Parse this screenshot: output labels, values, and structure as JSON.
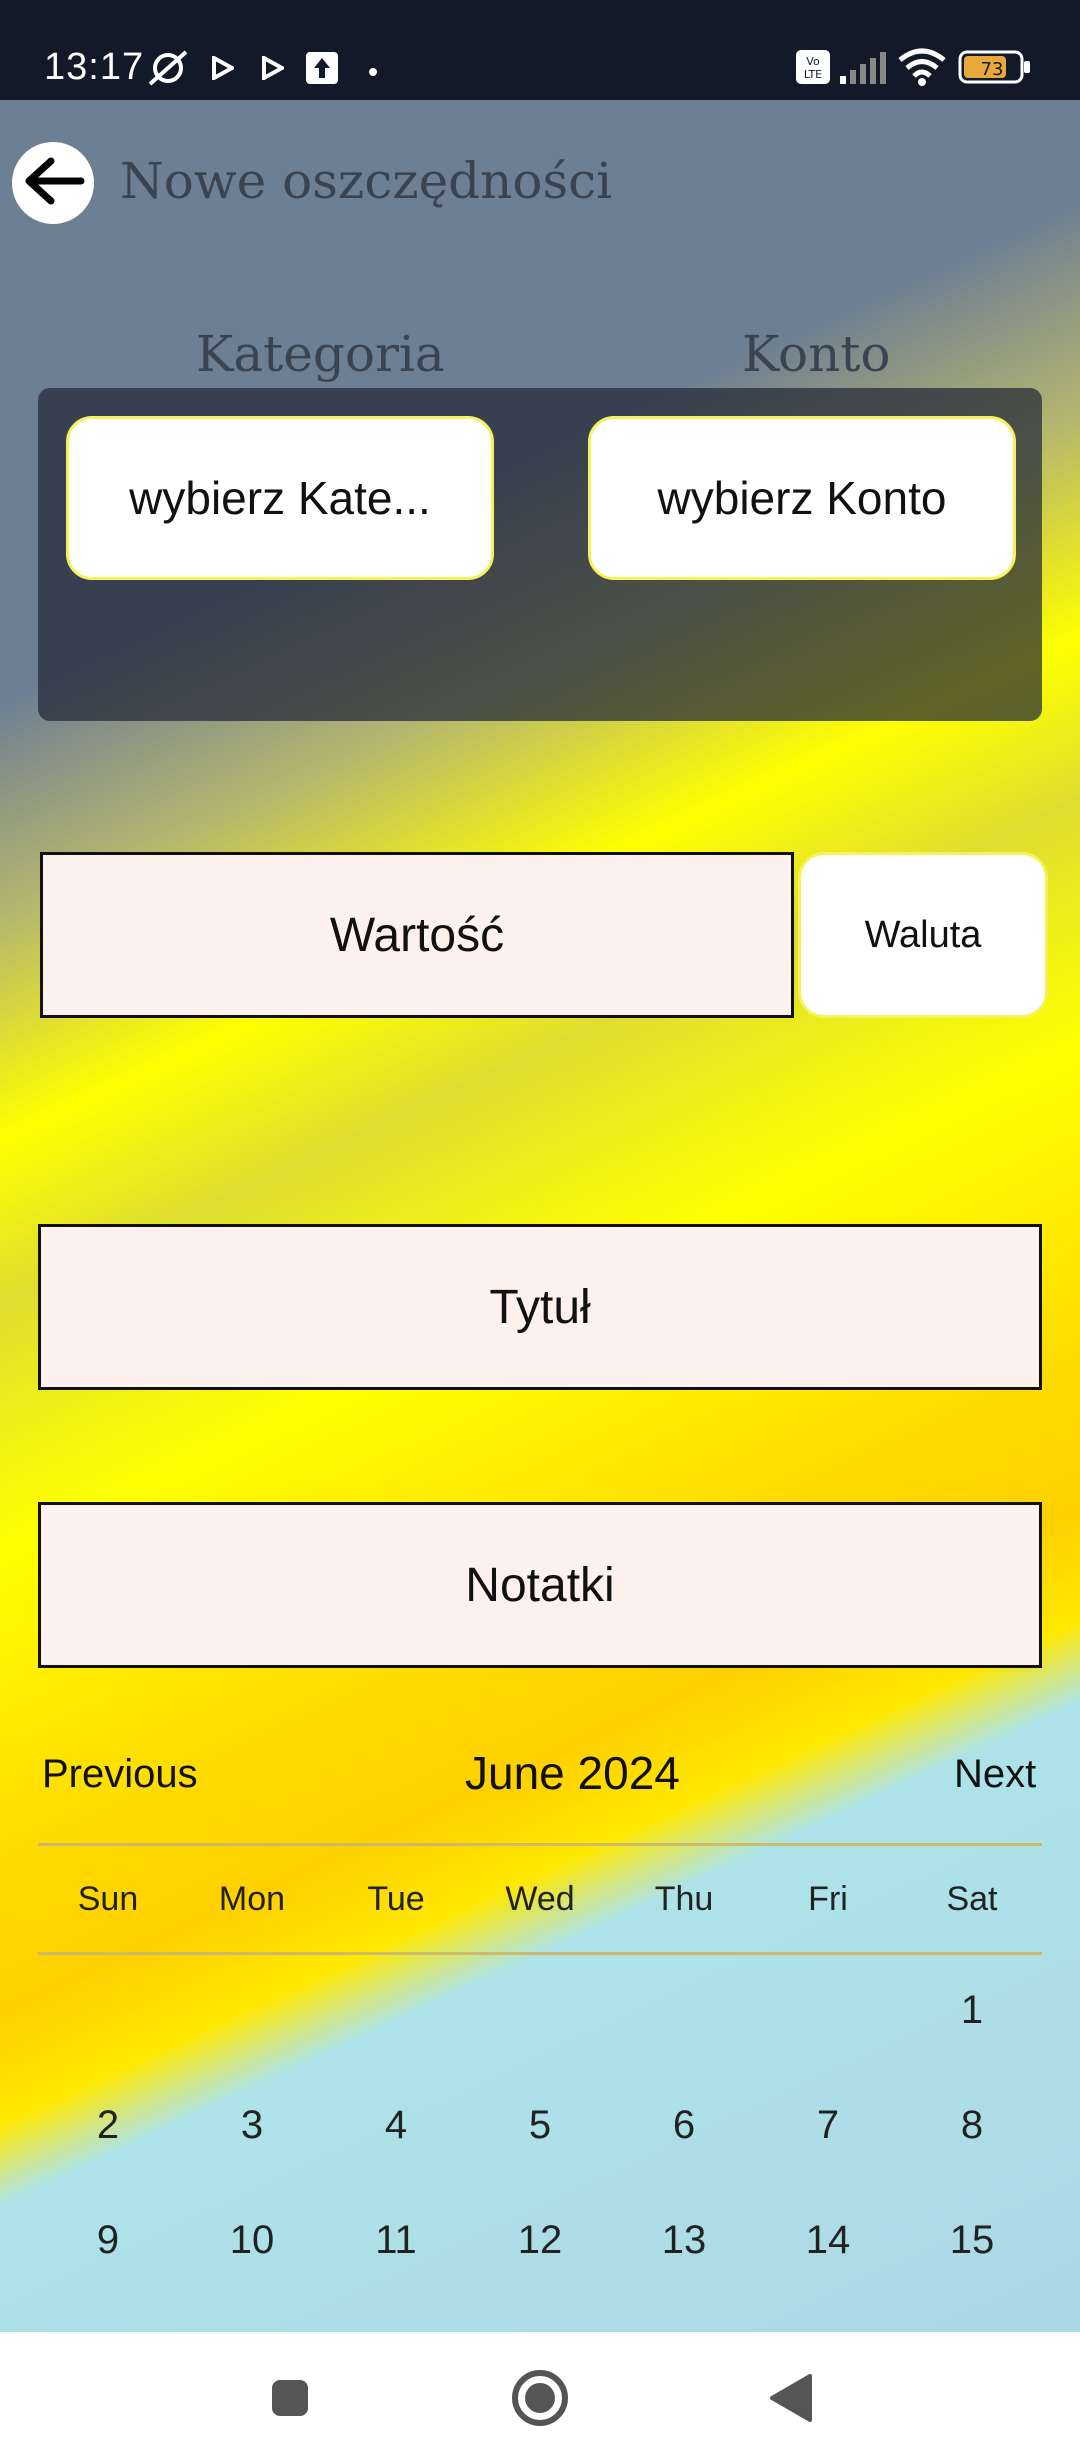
{
  "status_bar": {
    "time": "13:17",
    "battery": "73",
    "icons": [
      "muted-alarm-icon",
      "play-icon",
      "play-icon",
      "upload-icon",
      "dot-icon",
      "volte-icon",
      "signal-icon",
      "wifi-icon",
      "battery-icon"
    ]
  },
  "header": {
    "title": "Nowe oszczędności",
    "back_icon": "arrow-left-icon"
  },
  "category": {
    "label": "Kategoria",
    "button": "wybierz Kate..."
  },
  "account": {
    "label": "Konto",
    "button": "wybierz Konto"
  },
  "value_field": {
    "placeholder": "Wartość"
  },
  "currency_button": {
    "label": "Waluta"
  },
  "title_field": {
    "placeholder": "Tytuł"
  },
  "notes_field": {
    "placeholder": "Notatki"
  },
  "calendar": {
    "previous": "Previous",
    "next": "Next",
    "month": "June",
    "year": "2024",
    "weekdays": [
      "Sun",
      "Mon",
      "Tue",
      "Wed",
      "Thu",
      "Fri",
      "Sat"
    ],
    "weeks": [
      [
        "",
        "",
        "",
        "",
        "",
        "",
        "1"
      ],
      [
        "2",
        "3",
        "4",
        "5",
        "6",
        "7",
        "8"
      ],
      [
        "9",
        "10",
        "11",
        "12",
        "13",
        "14",
        "15"
      ]
    ],
    "selected_color": "#5fd400"
  },
  "nav_bar": {
    "icons": [
      "recents-square-icon",
      "home-circle-icon",
      "back-triangle-icon"
    ]
  },
  "colors": {
    "status_bar": "#121a2a",
    "field_bg": "#fdf1ee",
    "pill_border": "#f5f25a",
    "accent_yellow": "#ffff00",
    "sky_blue": "#add8e6"
  }
}
